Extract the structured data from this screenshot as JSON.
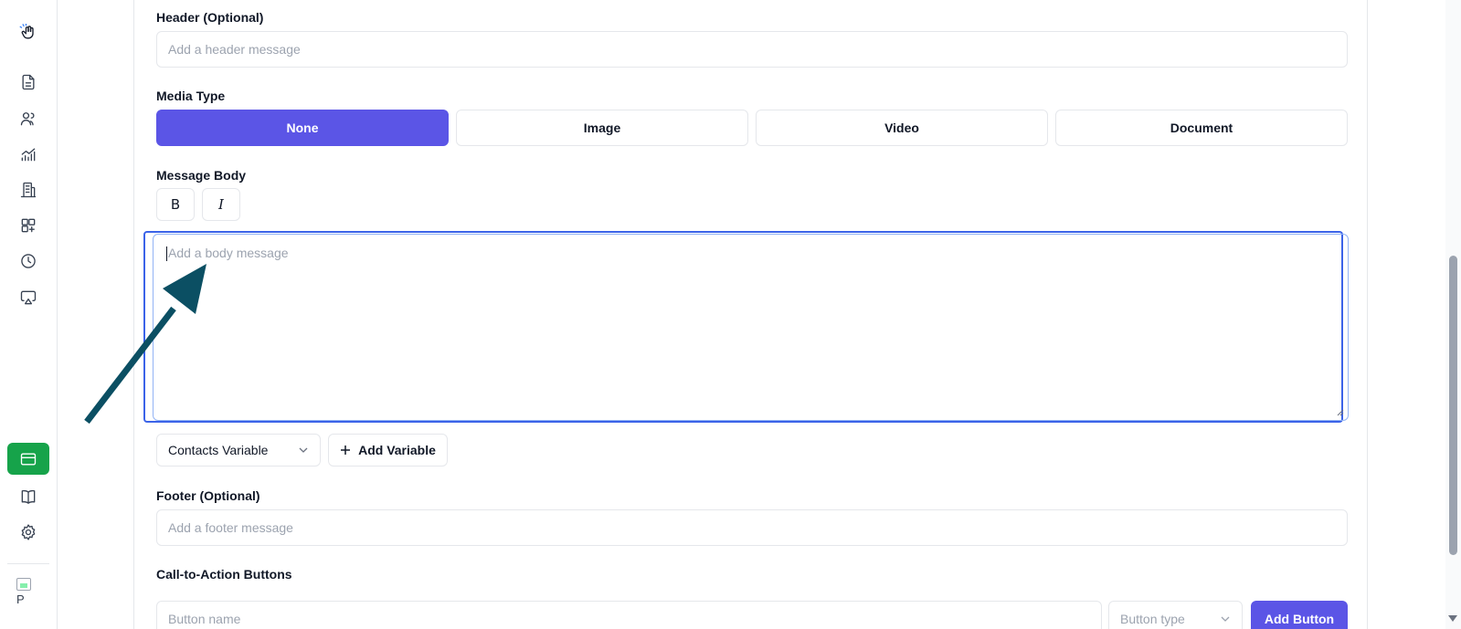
{
  "header_section": {
    "label": "Header (Optional)",
    "placeholder": "Add a header message"
  },
  "media_type": {
    "label": "Media Type",
    "options": [
      "None",
      "Image",
      "Video",
      "Document"
    ],
    "selected": "None"
  },
  "message_body": {
    "label": "Message Body",
    "bold_label": "B",
    "italic_label": "I",
    "placeholder": "Add a body message"
  },
  "variables": {
    "dropdown_value": "Contacts Variable",
    "add_variable_label": "Add Variable"
  },
  "footer_section": {
    "label": "Footer (Optional)",
    "placeholder": "Add a footer message"
  },
  "cta": {
    "label": "Call-to-Action Buttons",
    "button_name_placeholder": "Button name",
    "button_type_placeholder": "Button type",
    "add_button_label": "Add Button"
  },
  "sidebar": {
    "avatar_letter": "P",
    "icons": [
      "logo-icon",
      "document-icon",
      "users-icon",
      "analytics-icon",
      "building-icon",
      "apps-icon",
      "clock-icon",
      "broadcast-icon",
      "template-icon",
      "book-icon",
      "settings-icon"
    ]
  },
  "colors": {
    "primary": "#5b55e6",
    "sidebar_active": "#16a34a",
    "focus_border": "#3b63e8",
    "arrow": "#0b4f63"
  }
}
